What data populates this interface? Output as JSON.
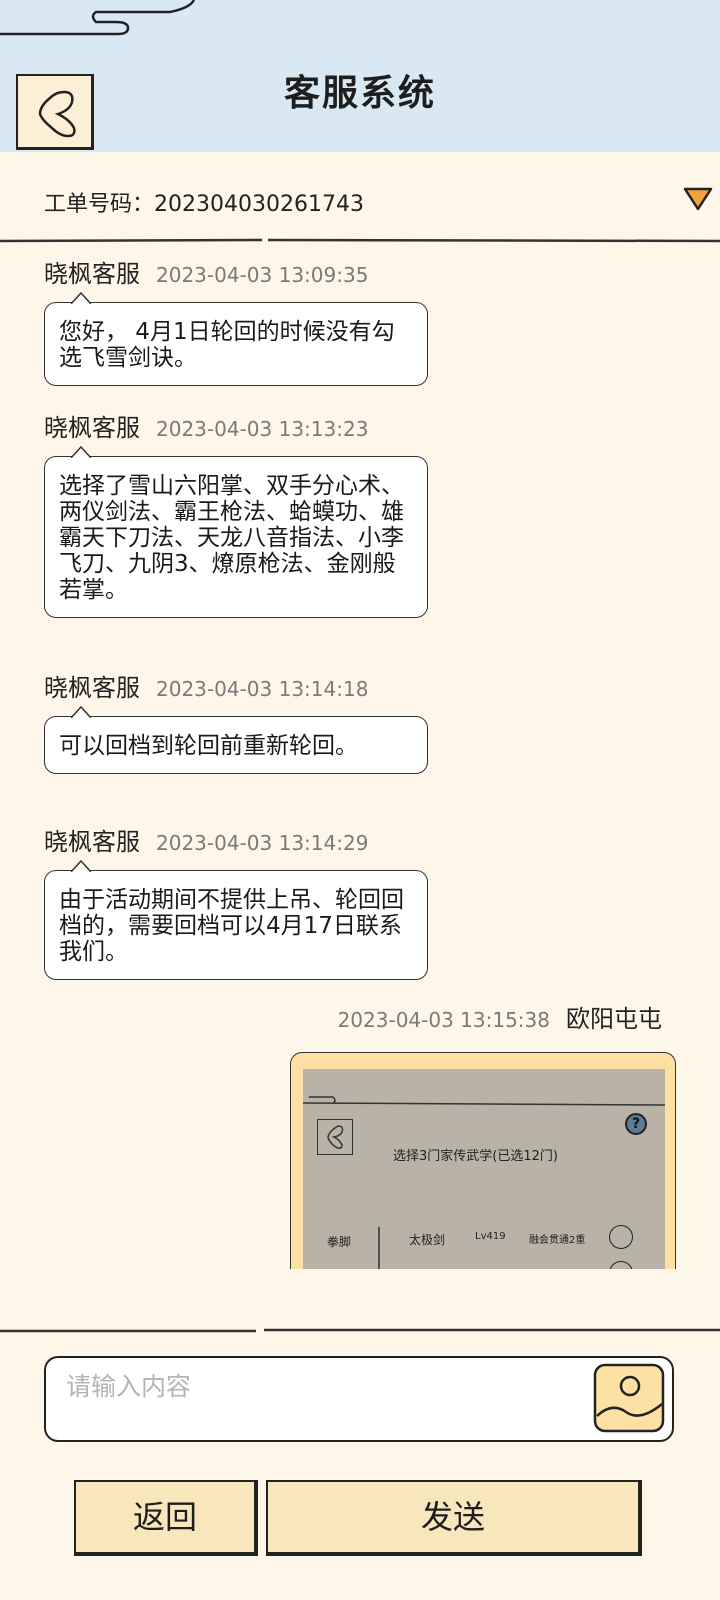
{
  "header": {
    "title": "客服系统"
  },
  "ticket": {
    "label": "工单号码：",
    "number": "202304030261743"
  },
  "messages": [
    {
      "sender": "晓枫客服",
      "time": "2023-04-03 13:09:35",
      "text": "您好， 4月1日轮回的时候没有勾选飞雪剑诀。"
    },
    {
      "sender": "晓枫客服",
      "time": "2023-04-03 13:13:23",
      "text": "选择了雪山六阳掌、双手分心术、两仪剑法、霸王枪法、蛤蟆功、雄霸天下刀法、天龙八音指法、小李飞刀、九阴3、燎原枪法、金刚般若掌。"
    },
    {
      "sender": "晓枫客服",
      "time": "2023-04-03 13:14:18",
      "text": "可以回档到轮回前重新轮回。"
    },
    {
      "sender": "晓枫客服",
      "time": "2023-04-03 13:14:29",
      "text": "由于活动期间不提供上吊、轮回回档的，需要回档可以4月17日联系我们。"
    }
  ],
  "my_message": {
    "sender": "欧阳屯屯",
    "time": "2023-04-03 13:15:38",
    "screenshot": {
      "title": "选择3门家传武学(已选12门)",
      "help": "?",
      "category": "拳脚",
      "skill_name": "太极剑",
      "skill_level": "Lv419",
      "skill_state": "融会贯通2重"
    }
  },
  "input": {
    "placeholder": "请输入内容"
  },
  "buttons": {
    "back": "返回",
    "send": "发送"
  },
  "colors": {
    "header_bg": "#d9e9f4",
    "page_bg": "#fdf6e9",
    "button_bg": "#f8e6bd",
    "my_bubble": "#fce0a4",
    "accent": "#f2a53a"
  }
}
